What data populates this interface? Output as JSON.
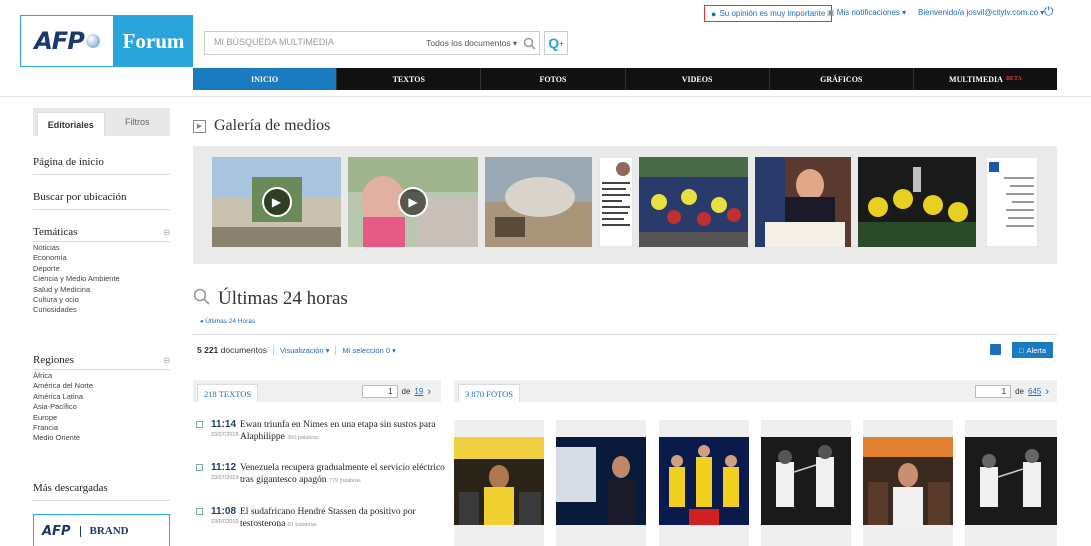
{
  "header": {
    "logo_afp": "AFP",
    "logo_forum": "Forum",
    "search_placeholder": "MI BÚSQUEDA MULTIMEDIA",
    "search_scope": "Todos los documentos",
    "opinion": "Su opinión es muy importante",
    "notifications": "Mis notificaciones ▾",
    "welcome": "Bienvenido/a josvil@citytv.com.co ▾"
  },
  "nav": [
    "INICIO",
    "TEXTOS",
    "FOTOS",
    "VIDEOS",
    "GRÁFICOS",
    "MULTIMEDIA"
  ],
  "nav_beta": "BETA",
  "sidebar": {
    "tabs": [
      "Editoriales",
      "Filtros"
    ],
    "home": "Página de inicio",
    "location": "Buscar por ubicación",
    "tematicas_title": "Temáticas",
    "tematicas": [
      "Noticias",
      "Economía",
      "Deporte",
      "Ciencia y Medio Ambiente",
      "Salud y Medicina",
      "Cultura y ocio",
      "Curiosidades"
    ],
    "regiones_title": "Regiones",
    "regiones": [
      "África",
      "América del Norte",
      "América Latina",
      "Asia-Pacífico",
      "Europe",
      "Francia",
      "Medio Oriente"
    ],
    "mas_descargadas": "Más descargadas",
    "brand_afp": "AFP",
    "brand_text": "BRAND"
  },
  "gallery": {
    "title": "Galería de medios"
  },
  "latest": {
    "title": "Últimas 24 horas",
    "sub": "Últimas 24 Horas",
    "count": "5 221",
    "count_label": "documentos",
    "visualizacion": "Visualización ▾",
    "seleccion": "Mi selección 0 ▾",
    "alert": "Alerta"
  },
  "textos": {
    "tab": "218 TEXTOS",
    "page": "1",
    "of": "de",
    "total": "19",
    "items": [
      {
        "time": "11:14",
        "title": "Ewan triunfa en Nimes en una etapa sin sustos para Alaphilippe",
        "date": "23/07/2019",
        "words": "360 palabras"
      },
      {
        "time": "11:12",
        "title": "Venezuela recupera gradualmente el servicio eléctrico tras gigantesco apagón",
        "date": "23/07/2019",
        "words": "779 palabras"
      },
      {
        "time": "11:08",
        "title": "El sudafricano Hendré Stassen da positivo por testosterona",
        "date": "23/07/2019",
        "words": "91 palabras"
      }
    ]
  },
  "fotos": {
    "tab": "3 870 FOTOS",
    "page": "1",
    "of": "de",
    "total": "645"
  },
  "colors": {
    "accent": "#1b7bc1",
    "logo_blue": "#29a5dc",
    "nav_bg": "#111111"
  }
}
